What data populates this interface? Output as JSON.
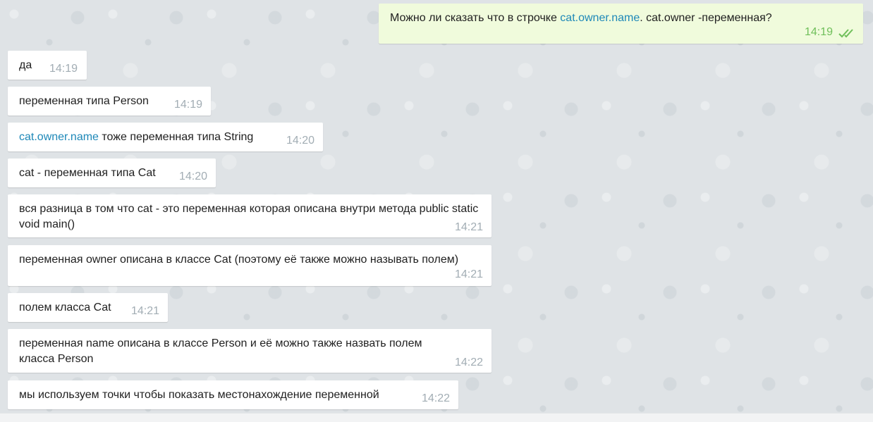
{
  "outgoing": {
    "before": "Можно ли сказать что в строчке ",
    "link": "cat.owner.name",
    "after": ". cat.owner -переменная?",
    "time": "14:19",
    "status_icon": "double-check-icon",
    "status_color": "#6fbf5a"
  },
  "messages": [
    {
      "text": "да",
      "time": "14:19"
    },
    {
      "text": "переменная типа Person",
      "time": "14:19"
    },
    {
      "link": "cat.owner.name",
      "text": " тоже переменная типа String",
      "time": "14:20"
    },
    {
      "text": "cat - переменная типа Cat",
      "time": "14:20"
    },
    {
      "text": "вся разница в том что cat - это переменная которая описана внутри метода public static void main()",
      "time": "14:21"
    },
    {
      "text": "переменная owner описана в классе Cat (поэтому её также можно называть полем)",
      "time": "14:21"
    },
    {
      "text": "полем класса Cat",
      "time": "14:21"
    },
    {
      "text": "переменная name описана в классе Person и её можно также назвать полем класса Person",
      "time": "14:22"
    },
    {
      "text": "мы используем точки чтобы показать местонахождение переменной",
      "time": "14:22"
    }
  ],
  "colors": {
    "background": "#dfe3e6",
    "incoming_bubble": "#ffffff",
    "outgoing_bubble": "#f0fbdc",
    "link": "#1e88b8",
    "timestamp": "#a2adb4"
  }
}
